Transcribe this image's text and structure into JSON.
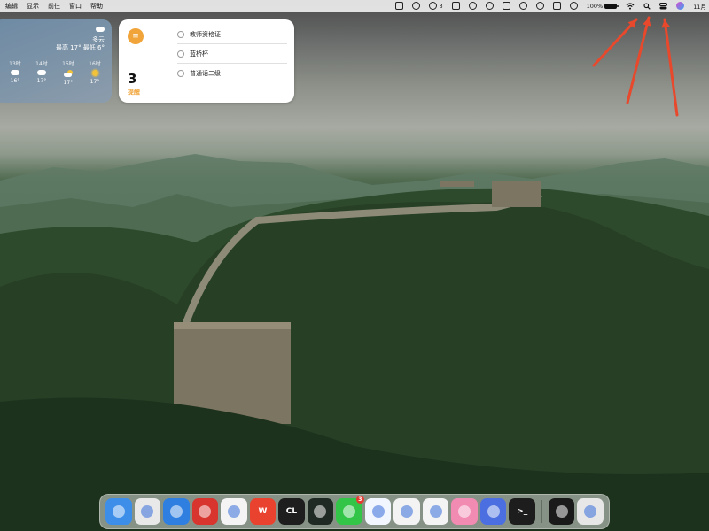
{
  "menubar": {
    "menus": [
      "编辑",
      "显示",
      "前往",
      "窗口",
      "帮助"
    ],
    "status_items": [
      {
        "name": "app-switch-icon",
        "label": ""
      },
      {
        "name": "keyboard-icon",
        "label": ""
      },
      {
        "name": "wechat-icon",
        "label": "3"
      },
      {
        "name": "airdrop-icon",
        "label": ""
      },
      {
        "name": "bluetooth-icon",
        "label": ""
      },
      {
        "name": "timemachine-icon",
        "label": ""
      },
      {
        "name": "info-icon",
        "label": ""
      },
      {
        "name": "user-icon",
        "label": ""
      },
      {
        "name": "monitor-icon",
        "label": ""
      },
      {
        "name": "cloud-icon",
        "label": ""
      },
      {
        "name": "display-icon",
        "label": ""
      }
    ],
    "battery_label": "100%",
    "battery_level": 100,
    "clock": "11月"
  },
  "weather": {
    "condition": "多云",
    "high_low": "最高 17° 最低 6°",
    "forecast": [
      {
        "time": "13时",
        "temp": "16°",
        "icon": "cloud-icon"
      },
      {
        "time": "14时",
        "temp": "17°",
        "icon": "cloud-icon"
      },
      {
        "time": "15时",
        "temp": "17°",
        "icon": "sun-cloud-icon"
      },
      {
        "time": "16时",
        "temp": "17°",
        "icon": "sun-icon"
      }
    ]
  },
  "reminders": {
    "count": "3",
    "label": "提醒",
    "items": [
      "教师资格证",
      "蓝桥杯",
      "普通话二级"
    ]
  },
  "dock": {
    "apps": [
      {
        "name": "finder",
        "label": "",
        "color": "#3d8ee8",
        "badge": ""
      },
      {
        "name": "launchpad",
        "label": "",
        "color": "#e9e9e9",
        "badge": ""
      },
      {
        "name": "safari",
        "label": "",
        "color": "#2f7fe0",
        "badge": ""
      },
      {
        "name": "netease-music",
        "label": "",
        "color": "#d7352d",
        "badge": ""
      },
      {
        "name": "freeform",
        "label": "",
        "color": "#f4f4f4",
        "badge": ""
      },
      {
        "name": "wps",
        "label": "W",
        "color": "#e9432f",
        "badge": ""
      },
      {
        "name": "clion",
        "label": "CL",
        "color": "#1e1e1e",
        "badge": ""
      },
      {
        "name": "pycharm",
        "label": "",
        "color": "#1f2a24",
        "badge": ""
      },
      {
        "name": "wechat",
        "label": "",
        "color": "#32c548",
        "badge": "3"
      },
      {
        "name": "qq-browser",
        "label": "",
        "color": "#f2f6ff",
        "badge": ""
      },
      {
        "name": "messages",
        "label": "",
        "color": "#f3f3f3",
        "badge": ""
      },
      {
        "name": "qq",
        "label": "",
        "color": "#f4f4f4",
        "badge": ""
      },
      {
        "name": "bilibili",
        "label": "",
        "color": "#f28bb2",
        "badge": ""
      },
      {
        "name": "screen-tool",
        "label": "",
        "color": "#4b6fe0",
        "badge": ""
      },
      {
        "name": "terminal",
        "label": ">_",
        "color": "#1d1d1d",
        "badge": ""
      }
    ],
    "extras": [
      {
        "name": "window-preview",
        "label": "",
        "color": "#1a1a1a"
      },
      {
        "name": "trash",
        "label": "",
        "color": "#e7e7e7"
      }
    ]
  },
  "colors": {
    "arrow": "#e8482c",
    "reminder_accent": "#f0a43a"
  }
}
